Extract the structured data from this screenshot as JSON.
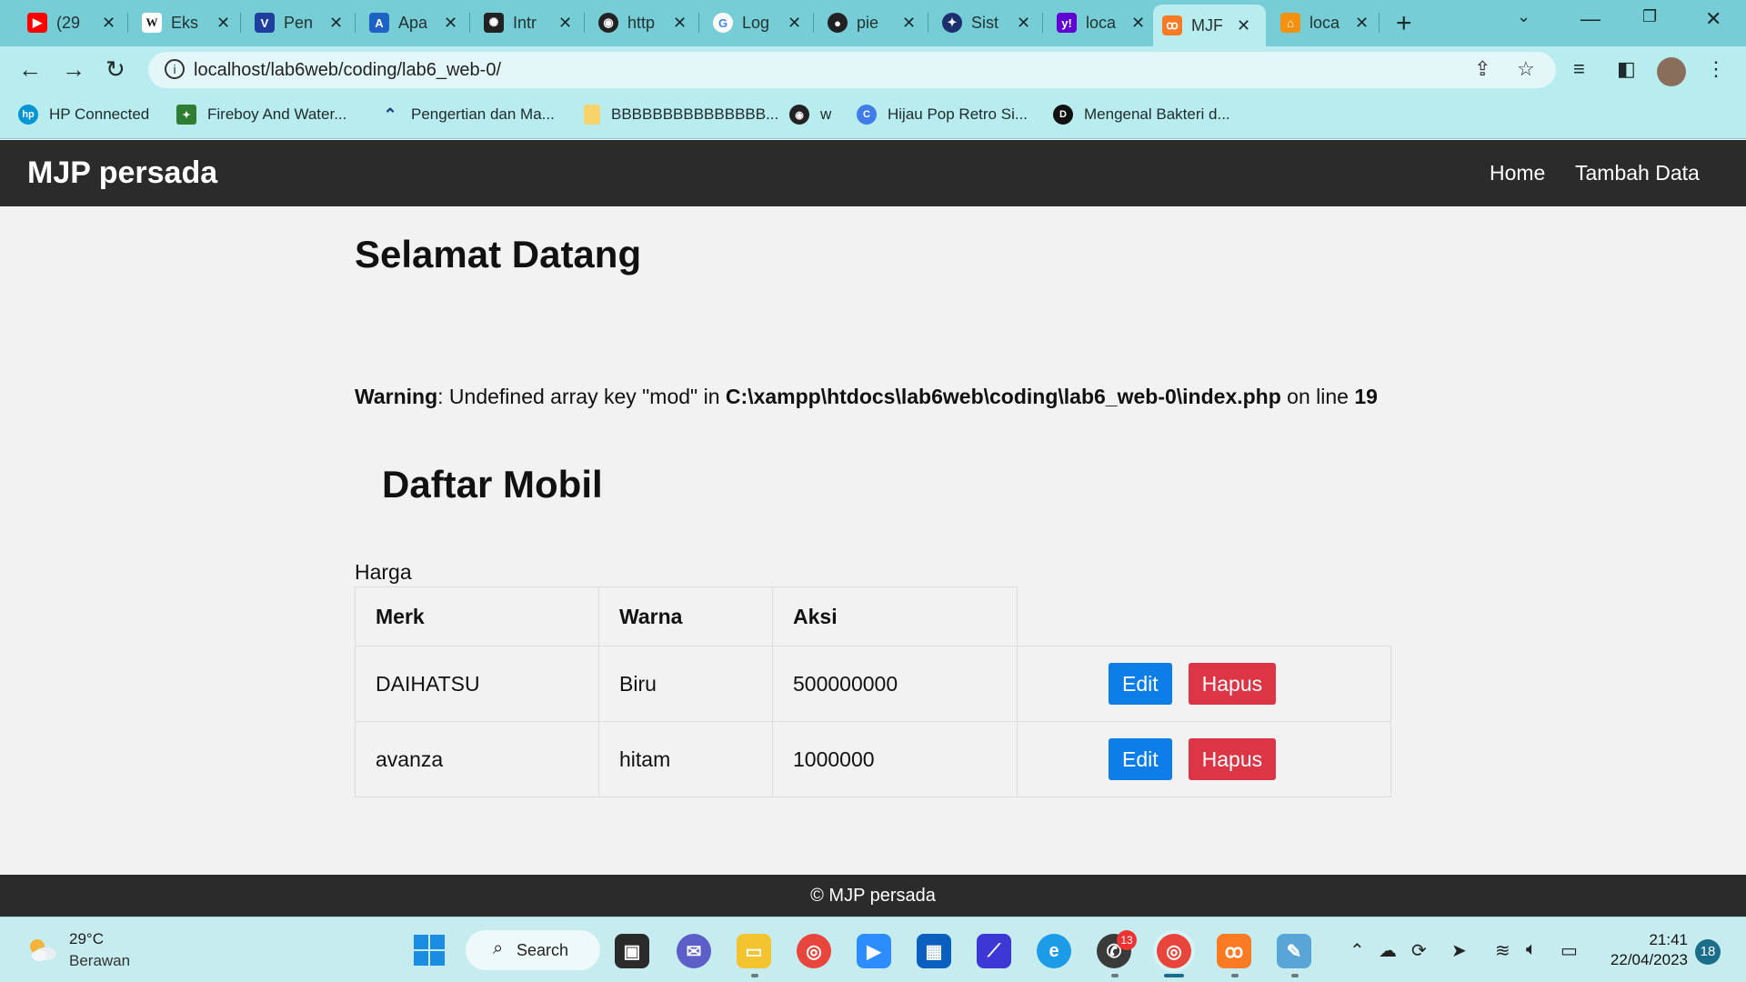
{
  "browser": {
    "tabs": [
      {
        "label": "(29",
        "favicon": "youtube-icon",
        "color": "#ff0000"
      },
      {
        "label": "Eks",
        "favicon": "wikipedia-icon",
        "color": "#ffffff"
      },
      {
        "label": "Pen",
        "favicon": "vector-icon",
        "color": "#1f3f9e"
      },
      {
        "label": "Apa",
        "favicon": "arrow-a-icon",
        "color": "#1e63c4"
      },
      {
        "label": "Intr",
        "favicon": "openai-icon",
        "color": "#222222"
      },
      {
        "label": "http",
        "favicon": "globe-icon",
        "color": "#222222"
      },
      {
        "label": "Log",
        "favicon": "google-icon",
        "color": "#ffffff"
      },
      {
        "label": "pie",
        "favicon": "github-icon",
        "color": "#222222"
      },
      {
        "label": "Sist",
        "favicon": "university-icon",
        "color": "#1c2f6e"
      },
      {
        "label": "loca",
        "favicon": "yahoo-icon",
        "color": "#6001d2"
      },
      {
        "label": "MJF",
        "favicon": "xampp-icon",
        "color": "#fb7a24",
        "active": true
      },
      {
        "label": "loca",
        "favicon": "phpmyadmin-icon",
        "color": "#f29111"
      }
    ],
    "url": "localhost/lab6web/coding/lab6_web-0/",
    "bookmarks": [
      {
        "label": "HP Connected",
        "icon": "hp-icon",
        "color": "#0096d6"
      },
      {
        "label": "Fireboy And Water...",
        "icon": "game-icon",
        "color": "#2e7d32"
      },
      {
        "label": "Pengertian dan Ma...",
        "icon": "arrow-icon",
        "color": "#1d3a7a"
      },
      {
        "label": "BBBBBBBBBBBBBBB...",
        "icon": "folder-icon",
        "color": "#f6d36b"
      },
      {
        "label": "w",
        "icon": "globe-icon",
        "color": "#222222"
      },
      {
        "label": "Hijau Pop Retro Si...",
        "icon": "canva-icon",
        "color": "#3f7ee8"
      },
      {
        "label": "Mengenal Bakteri d...",
        "icon": "d-icon",
        "color": "#111111"
      }
    ]
  },
  "site": {
    "brand": "MJP persada",
    "nav": {
      "home": "Home",
      "add": "Tambah Data"
    },
    "heading": "Selamat Datang",
    "warning": {
      "label": "Warning",
      "message": ": Undefined array key \"mod\" in ",
      "path": "C:\\xampp\\htdocs\\lab6web\\coding\\lab6_web-0\\index.php",
      "on": " on line ",
      "line": "19"
    },
    "list_title": "Daftar Mobil",
    "stray_label": "Harga",
    "table": {
      "headers": [
        "Merk",
        "Warna",
        "Aksi"
      ],
      "rows": [
        {
          "merk": "DAIHATSU",
          "warna": "Biru",
          "harga": "500000000"
        },
        {
          "merk": "avanza",
          "warna": "hitam",
          "harga": "1000000"
        }
      ],
      "edit_label": "Edit",
      "delete_label": "Hapus"
    },
    "footer": "© MJP persada"
  },
  "taskbar": {
    "weather": {
      "temp": "29°C",
      "desc": "Berawan"
    },
    "search_label": "Search",
    "whatsapp_badge": "13",
    "time": "21:41",
    "date": "22/04/2023",
    "notification_count": "18"
  },
  "colors": {
    "navbar": "#2b2b2b",
    "edit_button": "#0d7ee8",
    "delete_button": "#dc3545",
    "tab_strip": "#76cdd6",
    "toolbar": "#b9ecef"
  }
}
